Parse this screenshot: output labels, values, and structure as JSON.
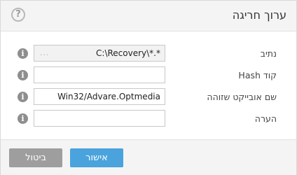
{
  "dialog": {
    "title": "ערוך חריגה",
    "help_glyph": "?"
  },
  "fields": {
    "path": {
      "label": "נתיב",
      "value": "C:\\Recovery\\*.*",
      "overflow_dots": "..."
    },
    "hash": {
      "label": "קוד Hash",
      "value": ""
    },
    "object_name": {
      "label": "שם אובייקט שזוהה",
      "value": "Win32/Advare.Optmedia"
    },
    "comment": {
      "label": "הערה",
      "value": ""
    },
    "info_glyph": "i"
  },
  "footer": {
    "ok_label": "אישור",
    "cancel_label": "ביטול"
  },
  "colors": {
    "ok_button": "#4aa3dc",
    "cancel_button": "#9e9e9e",
    "header_bg": "#f4f4f4"
  }
}
